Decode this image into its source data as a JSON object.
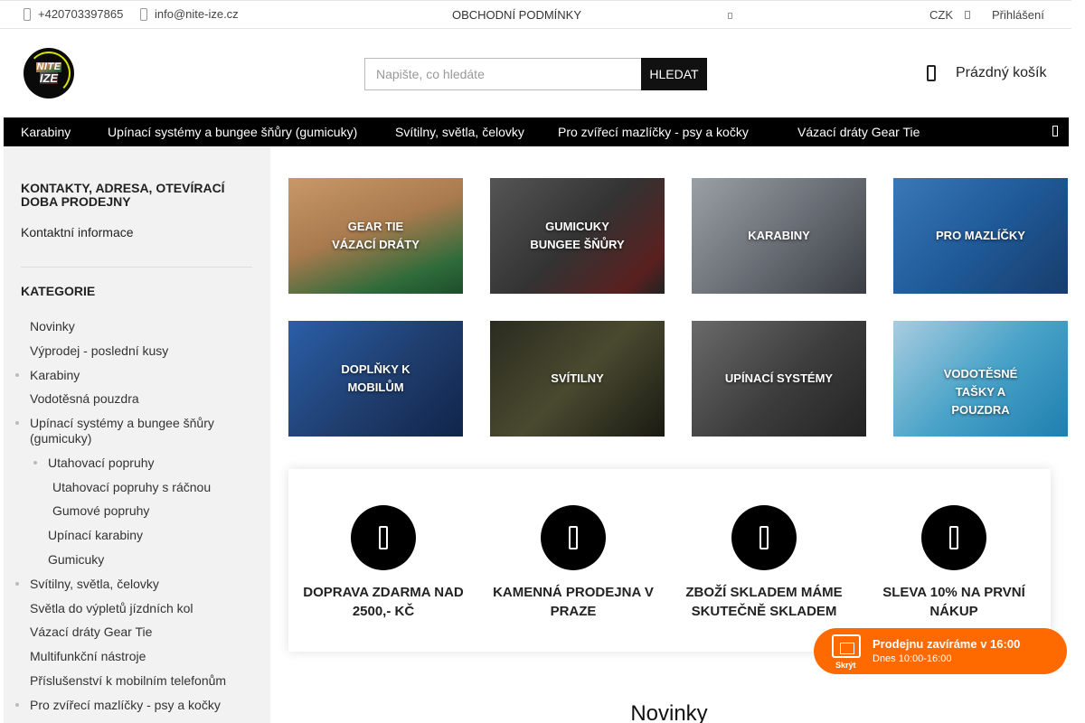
{
  "topbar": {
    "phone": "+420703397865",
    "email": "info@nite-ize.cz",
    "terms": "OBCHODNÍ PODMÍNKY",
    "currency": "CZK",
    "login": "Přihlášení"
  },
  "header": {
    "logo_line1": "NITE",
    "logo_line2": "IZE",
    "search_placeholder": "Napište, co hledáte",
    "search_button": "HLEDAT",
    "cart_label": "Prázdný košík"
  },
  "nav": [
    {
      "label": "Karabiny"
    },
    {
      "label": "Upínací systémy a bungee šňůry (gumicuky)"
    },
    {
      "label": "Svítilny, světla, čelovky"
    },
    {
      "label": " Pro zvířecí mazlíčky - psy a kočky"
    },
    {
      "label": "Vázací dráty Gear Tie"
    }
  ],
  "sidebar": {
    "contacts_heading": "KONTAKTY, ADRESA, OTEVÍRACÍ DOBA PRODEJNY",
    "contacts_link": "Kontaktní informace",
    "categories_heading": "KATEGORIE",
    "categories": [
      {
        "label": " Novinky"
      },
      {
        "label": " Výprodej - poslední kusy"
      },
      {
        "label": "Karabiny"
      },
      {
        "label": "Vodotěsná pouzdra"
      },
      {
        "label": "Upínací systémy a bungee šňůry (gumicuky)"
      },
      {
        "label": "Utahovací popruhy"
      },
      {
        "label": "Utahovací popruhy s ráčnou"
      },
      {
        "label": "Gumové popruhy"
      },
      {
        "label": "Upínací karabiny"
      },
      {
        "label": "Gumicuky"
      },
      {
        "label": "Svítilny, světla, čelovky"
      },
      {
        "label": "Světla do výpletů jízdních kol"
      },
      {
        "label": "Vázací dráty Gear Tie"
      },
      {
        "label": "Multifunkční nástroje"
      },
      {
        "label": "Příslušenství k mobilním telefonům"
      },
      {
        "label": " Pro zvířecí mazlíčky - psy a kočky"
      }
    ]
  },
  "tiles": [
    {
      "line1": "GEAR TIE",
      "line2": "VÁZACÍ DRÁTY"
    },
    {
      "line1": "GUMICUKY",
      "line2": "BUNGEE ŠŇŮRY"
    },
    {
      "line1": "KARABINY",
      "line2": ""
    },
    {
      "line1": "PRO MAZLÍČKY",
      "line2": ""
    },
    {
      "line1": "DOPLŇKY K",
      "line2": "MOBILŮM"
    },
    {
      "line1": "SVÍTILNY",
      "line2": ""
    },
    {
      "line1": "UPÍNACÍ SYSTÉMY",
      "line2": ""
    },
    {
      "line1": "VODOTĚSNÉ",
      "line2": "TAŠKY A",
      "line3": "POUZDRA"
    }
  ],
  "benefits": [
    {
      "line1": "DOPRAVA ZDARMA NAD",
      "line2": "2500,- KČ"
    },
    {
      "line1": "KAMENNÁ PRODEJNA V",
      "line2": "PRAZE"
    },
    {
      "line1": "ZBOŽÍ SKLADEM MÁME",
      "line2": "SKUTEČNĚ SKLADEM"
    },
    {
      "line1": "SLEVA 10% NA PRVNÍ",
      "line2": "NÁKUP"
    }
  ],
  "store_widget": {
    "hide": "Skrýt",
    "title": "Prodejnu zavíráme v 16:00",
    "hours": "Dnes 10:00-16:00"
  },
  "section_title": "Novinky"
}
